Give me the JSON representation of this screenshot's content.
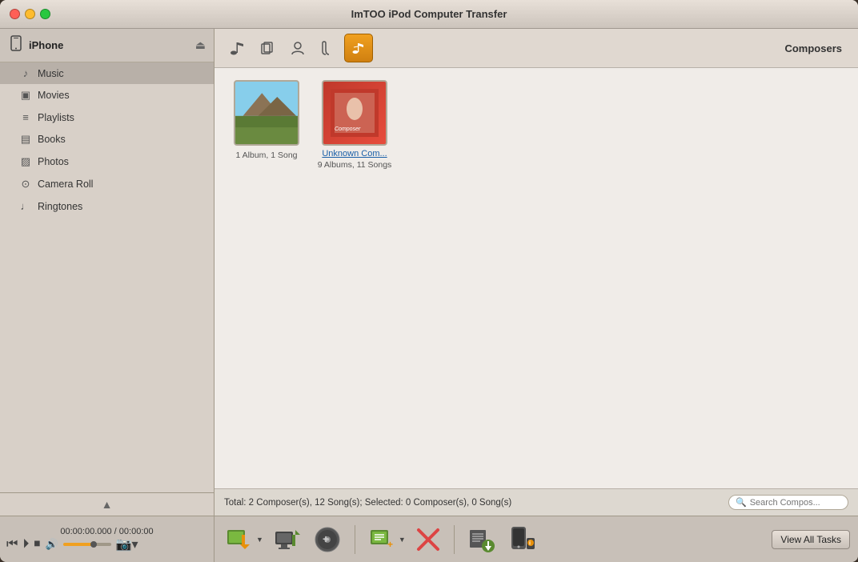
{
  "window": {
    "title": "ImTOO iPod Computer Transfer"
  },
  "titlebar": {
    "close": "×",
    "minimize": "–",
    "maximize": "+"
  },
  "device": {
    "name": "iPhone",
    "icon": "📱"
  },
  "sidebar": {
    "items": [
      {
        "id": "music",
        "label": "Music",
        "icon": "♪",
        "active": true
      },
      {
        "id": "movies",
        "label": "Movies",
        "icon": "▣"
      },
      {
        "id": "playlists",
        "label": "Playlists",
        "icon": "≡"
      },
      {
        "id": "books",
        "label": "Books",
        "icon": "▤"
      },
      {
        "id": "photos",
        "label": "Photos",
        "icon": "▨"
      },
      {
        "id": "camera-roll",
        "label": "Camera Roll",
        "icon": "⊙"
      },
      {
        "id": "ringtones",
        "label": "Ringtones",
        "icon": "♩"
      }
    ]
  },
  "toolbar": {
    "tabs": [
      {
        "id": "songs",
        "icon": "♪",
        "active": false
      },
      {
        "id": "albums",
        "icon": "▣",
        "active": false
      },
      {
        "id": "artists",
        "icon": "👤",
        "active": false
      },
      {
        "id": "genres",
        "icon": "♬",
        "active": false
      },
      {
        "id": "composers",
        "icon": "♩",
        "active": true
      }
    ],
    "active_label": "Composers"
  },
  "composers": [
    {
      "id": "composer-1",
      "name": "",
      "albums": "1 Album, 1 Song",
      "type": "mountain"
    },
    {
      "id": "composer-2",
      "name": "Unknown Com...",
      "albums": "9 Albums, 11 Songs",
      "type": "album"
    }
  ],
  "status": {
    "text": "Total: 2 Composer(s), 12 Song(s); Selected: 0 Composer(s), 0 Song(s)"
  },
  "search": {
    "placeholder": "Search Compos..."
  },
  "playback": {
    "time": "00:00:00.000 / 00:00:00"
  },
  "actions": {
    "view_all_tasks": "View All Tasks",
    "add_to_device": "Add to Device",
    "transfer_to_pc": "Transfer to PC",
    "add_song": "Add Song",
    "add_playlist": "Add Playlist",
    "delete": "Delete",
    "export_list": "Export List",
    "device_info": "Device Info"
  }
}
